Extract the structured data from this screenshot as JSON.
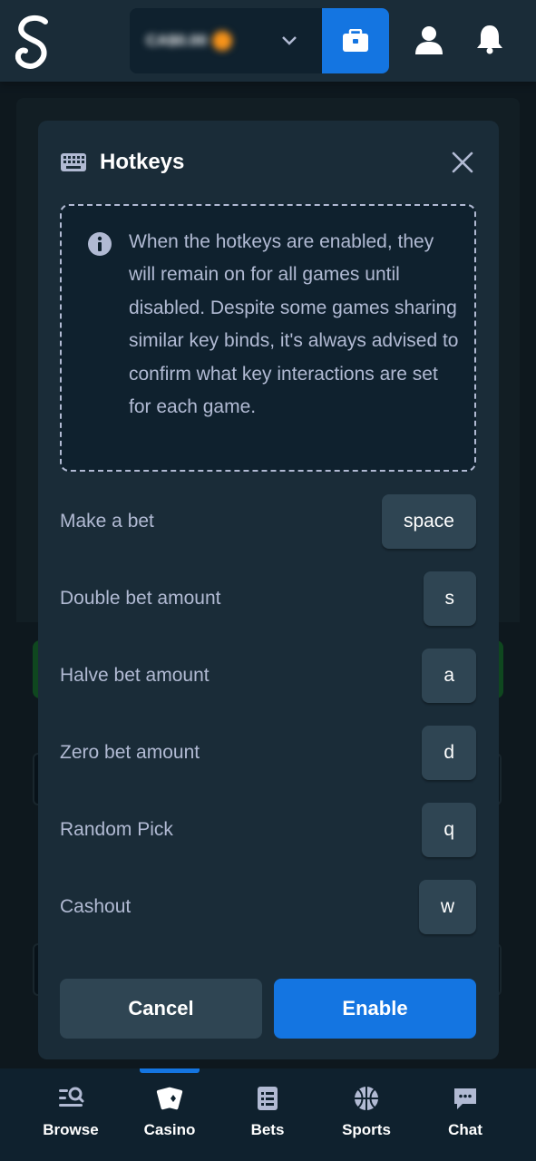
{
  "header": {
    "logo_text": "S",
    "balance": "CA$0.00"
  },
  "modal": {
    "title": "Hotkeys",
    "info_text": "When the hotkeys are enabled, they will remain on for all games until disabled. Despite some games sharing similar key binds, it's always advised to confirm what key interactions are set for each game.",
    "hotkeys": [
      {
        "label": "Make a bet",
        "key": "space"
      },
      {
        "label": "Double bet amount",
        "key": "s"
      },
      {
        "label": "Halve bet amount",
        "key": "a"
      },
      {
        "label": "Zero bet amount",
        "key": "d"
      },
      {
        "label": "Random Pick",
        "key": "q"
      },
      {
        "label": "Cashout",
        "key": "w"
      }
    ],
    "cancel_label": "Cancel",
    "enable_label": "Enable"
  },
  "bottom_nav": {
    "items": [
      {
        "label": "Browse",
        "icon": "browse-icon"
      },
      {
        "label": "Casino",
        "icon": "cards-icon"
      },
      {
        "label": "Bets",
        "icon": "betslip-icon"
      },
      {
        "label": "Sports",
        "icon": "basketball-icon"
      },
      {
        "label": "Chat",
        "icon": "chat-icon"
      }
    ],
    "active": "Casino"
  },
  "colors": {
    "background": "#1a2c38",
    "panel": "#0f212e",
    "accent": "#1475e1",
    "key_bg": "#2f4553",
    "text_muted": "#b1bad3"
  }
}
